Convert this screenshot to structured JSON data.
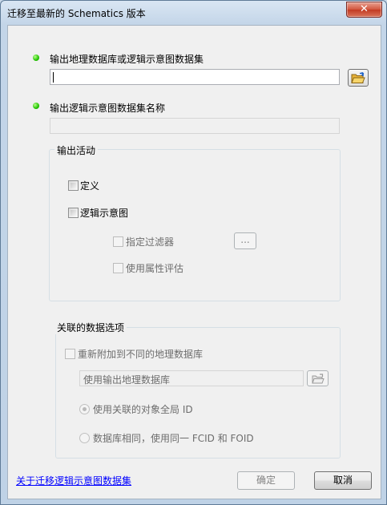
{
  "window": {
    "title": "迁移至最新的 Schematics 版本",
    "close_symbol": "✕"
  },
  "output_gdb": {
    "label": "输出地理数据库或逻辑示意图数据集",
    "value": ""
  },
  "output_name": {
    "label": "输出逻辑示意图数据集名称",
    "value": ""
  },
  "output_activity": {
    "title": "输出活动",
    "definition_label": "定义",
    "diagram_label": "逻辑示意图",
    "filter_label": "指定过滤器",
    "filter_button": "...",
    "attr_label": "使用属性评估"
  },
  "associated": {
    "title": "关联的数据选项",
    "reattach_label": "重新附加到不同的地理数据库",
    "gdb_value": "使用输出地理数据库",
    "radio1_label": "使用关联的对象全局 ID",
    "radio2_label": "数据库相同，使用同一 FCID 和 FOID"
  },
  "footer": {
    "help_link": "关于迁移逻辑示意图数据集",
    "ok_label": "确定",
    "cancel_label": "取消"
  },
  "colors": {
    "status_dot": "#22c400",
    "link": "#0000ff",
    "close": "#c23a22"
  },
  "icons": [
    "open-folder-icon",
    "close-icon",
    "status-dot-icon"
  ]
}
